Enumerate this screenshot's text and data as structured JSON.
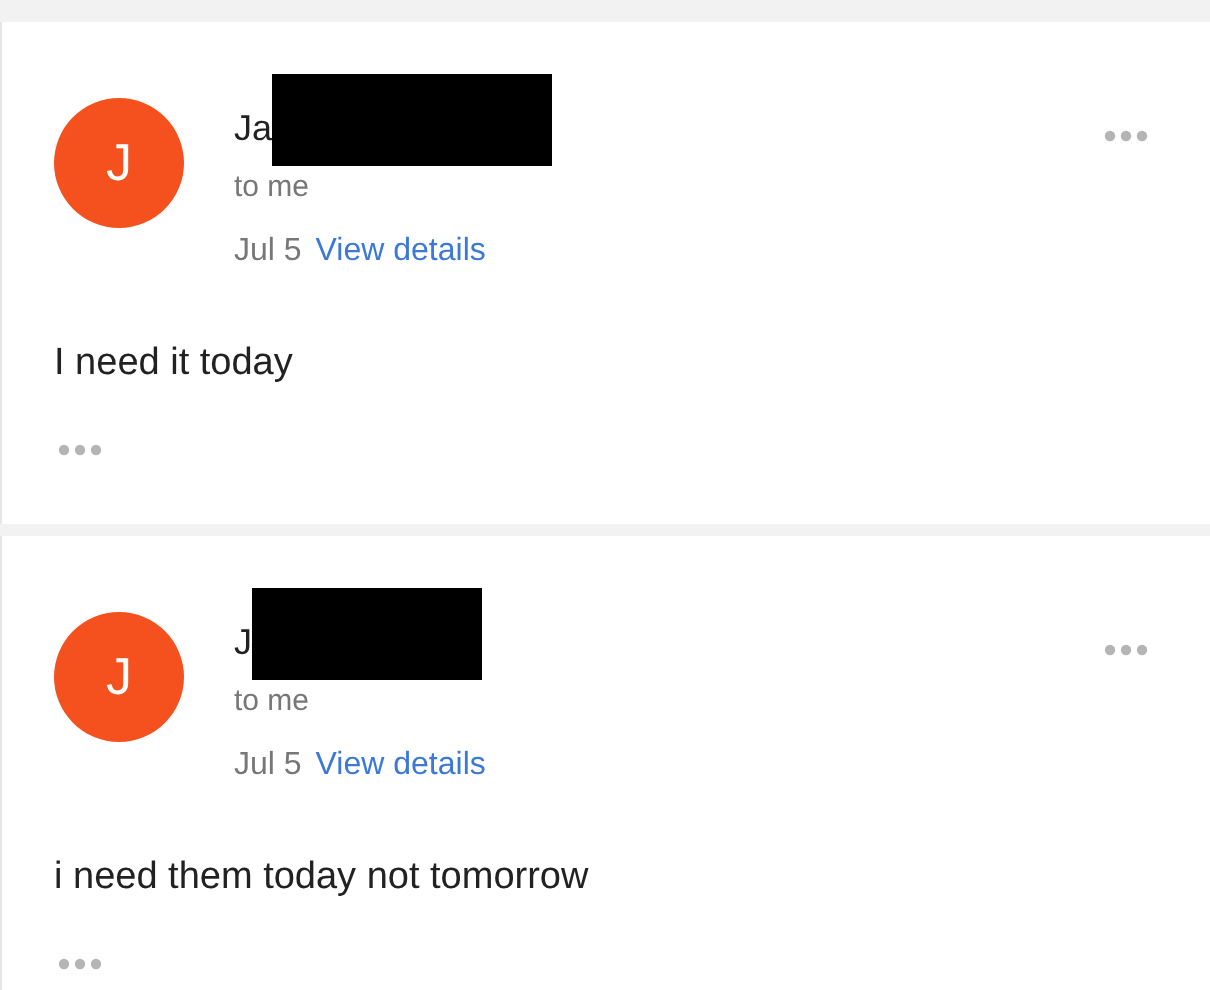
{
  "messages": [
    {
      "avatar": "J",
      "sender": "Ja",
      "recipient": "to me",
      "date": "Jul 5",
      "details_link": "View details",
      "body": "I need it today"
    },
    {
      "avatar": "J",
      "sender": "J",
      "recipient": "to me",
      "date": "Jul 5",
      "details_link": "View details",
      "body": "i need them today not tomorrow"
    }
  ]
}
